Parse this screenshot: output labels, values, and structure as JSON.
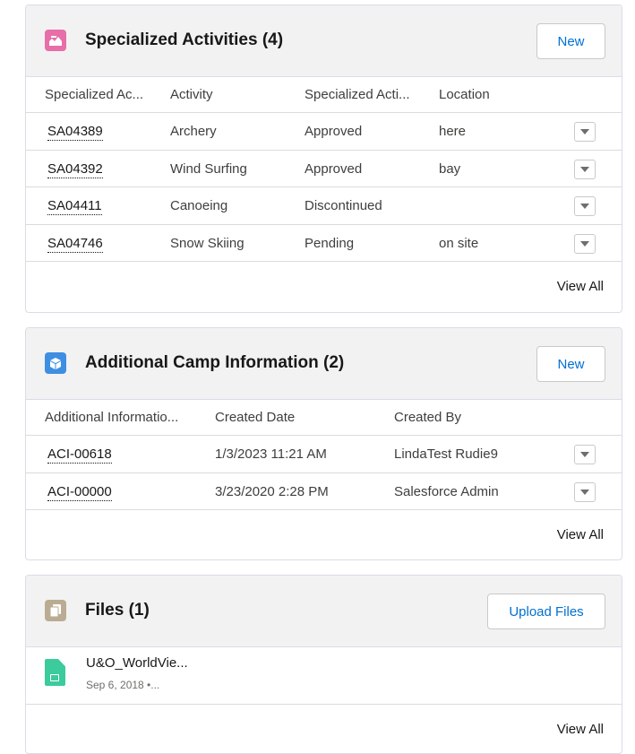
{
  "specialized": {
    "title": "Specialized Activities (4)",
    "new_label": "New",
    "icon": "specialized-activity-icon",
    "icon_color": "#e76ea8",
    "columns": [
      "Specialized Ac...",
      "Activity",
      "Specialized Acti...",
      "Location"
    ],
    "rows": [
      {
        "id": "SA04389",
        "activity": "Archery",
        "status": "Approved",
        "location": "here"
      },
      {
        "id": "SA04392",
        "activity": "Wind Surfing",
        "status": "Approved",
        "location": "bay"
      },
      {
        "id": "SA04411",
        "activity": "Canoeing",
        "status": "Discontinued",
        "location": ""
      },
      {
        "id": "SA04746",
        "activity": "Snow Skiing",
        "status": "Pending",
        "location": "on site"
      }
    ],
    "view_all": "View All"
  },
  "camp": {
    "title": "Additional Camp Information (2)",
    "new_label": "New",
    "icon": "cube-icon",
    "icon_color": "#3e8fe2",
    "columns": [
      "Additional Informatio...",
      "Created Date",
      "Created By"
    ],
    "rows": [
      {
        "id": "ACI-00618",
        "created_date": "1/3/2023 11:21 AM",
        "created_by": "LindaTest Rudie9"
      },
      {
        "id": "ACI-00000",
        "created_date": "3/23/2020 2:28 PM",
        "created_by": "Salesforce Admin"
      }
    ],
    "view_all": "View All"
  },
  "files": {
    "title": "Files (1)",
    "upload_label": "Upload Files",
    "icon": "files-icon",
    "icon_color": "#baac93",
    "file_icon_color": "#3bcb9c",
    "items": [
      {
        "name": "U&O_WorldVie...",
        "meta": "Sep 6, 2018 •..."
      }
    ],
    "view_all": "View All"
  }
}
